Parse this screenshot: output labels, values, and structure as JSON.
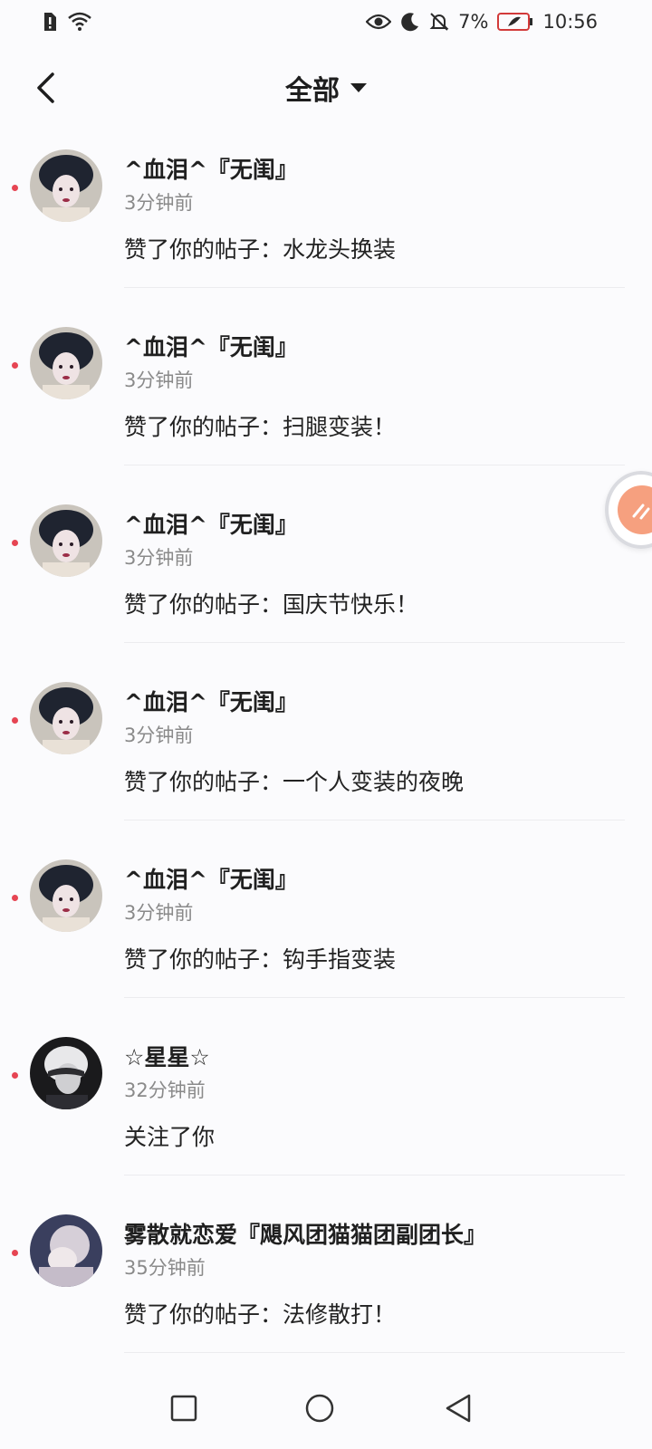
{
  "status_bar": {
    "left_icons": [
      "alert-sim-icon",
      "wifi-icon"
    ],
    "right_icons": [
      "eye-icon",
      "moon-icon",
      "bell-off-icon"
    ],
    "battery_text": "7%",
    "time": "10:56"
  },
  "header": {
    "title": "全部"
  },
  "notifications": [
    {
      "name": "^血泪^『无闺』",
      "time": "3分钟前",
      "action": "赞了你的帖子：水龙头换装"
    },
    {
      "name": "^血泪^『无闺』",
      "time": "3分钟前",
      "action": "赞了你的帖子：扫腿变装！"
    },
    {
      "name": "^血泪^『无闺』",
      "time": "3分钟前",
      "action": "赞了你的帖子：国庆节快乐！"
    },
    {
      "name": "^血泪^『无闺』",
      "time": "3分钟前",
      "action": "赞了你的帖子：一个人变装的夜晚"
    },
    {
      "name": "^血泪^『无闺』",
      "time": "3分钟前",
      "action": "赞了你的帖子：钩手指变装"
    },
    {
      "name": "☆星星☆",
      "time": "32分钟前",
      "action": "关注了你"
    },
    {
      "name": "雾散就恋爱『飓风团猫猫团副团长』",
      "time": "35分钟前",
      "action": "赞了你的帖子：法修散打！"
    }
  ],
  "colors": {
    "unread_dot": "#e64553",
    "float_button": "#f6a07f"
  }
}
